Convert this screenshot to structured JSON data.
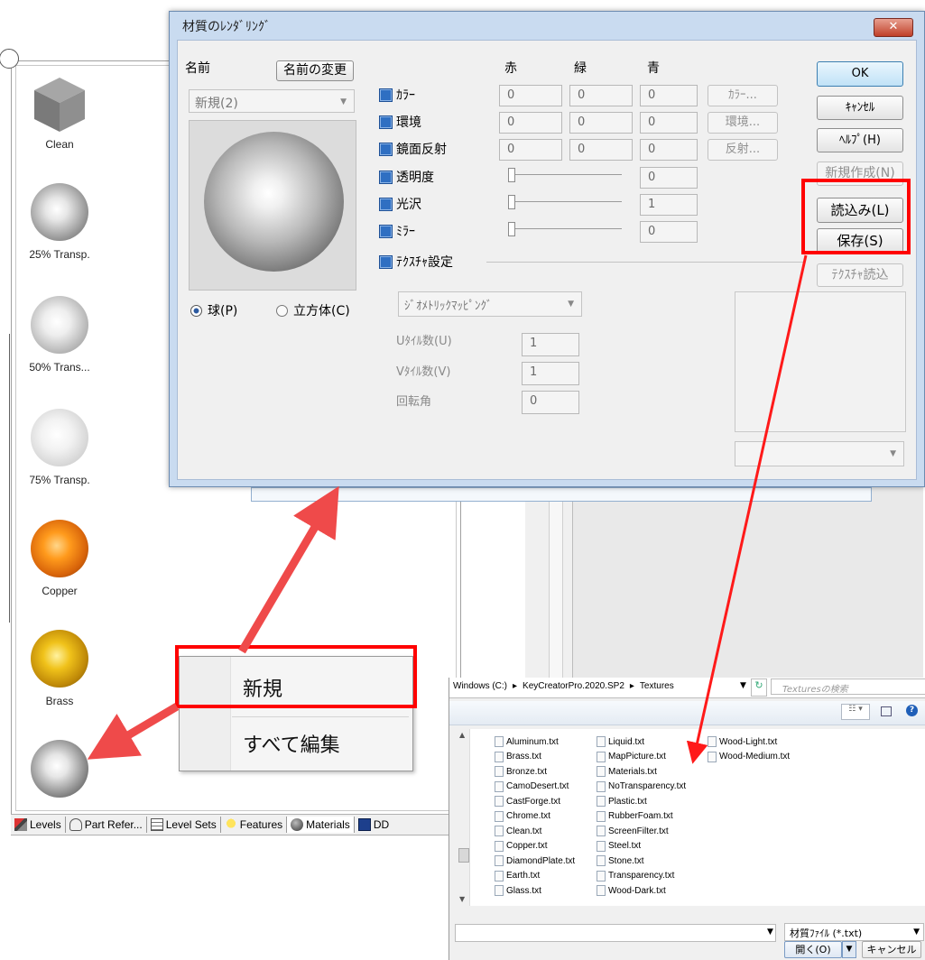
{
  "materials_panel": {
    "items": [
      {
        "label": "Clean"
      },
      {
        "label": "25% Transp."
      },
      {
        "label": "50% Trans..."
      },
      {
        "label": "75% Transp."
      },
      {
        "label": "Copper"
      },
      {
        "label": "Brass"
      }
    ],
    "tabs": [
      {
        "label": "Levels",
        "icon": "levels-icon"
      },
      {
        "label": "Part Refer...",
        "icon": "part-references-icon"
      },
      {
        "label": "Level Sets",
        "icon": "level-sets-icon"
      },
      {
        "label": "Features",
        "icon": "lightbulb-icon"
      },
      {
        "label": "Materials",
        "icon": "materials-globe-icon"
      },
      {
        "label": "DD",
        "icon": "dd-icon"
      }
    ]
  },
  "dialog": {
    "title": "材質のﾚﾝﾀﾞﾘﾝｸﾞ",
    "close_label": "✕",
    "name_label": "名前",
    "rename_button": "名前の変更",
    "name_value": "新規(2)",
    "preview_shape_sphere": "球(P)",
    "preview_shape_cube": "立方体(C)",
    "col_red": "赤",
    "col_green": "緑",
    "col_blue": "青",
    "rows": [
      {
        "label": "ｶﾗｰ",
        "r": "0",
        "g": "0",
        "b": "0",
        "button": "ｶﾗｰ..."
      },
      {
        "label": "環境",
        "r": "0",
        "g": "0",
        "b": "0",
        "button": "環境..."
      },
      {
        "label": "鏡面反射",
        "r": "0",
        "g": "0",
        "b": "0",
        "button": "反射..."
      }
    ],
    "sliders": [
      {
        "label": "透明度",
        "value": "0"
      },
      {
        "label": "光沢",
        "value": "1"
      },
      {
        "label": "ﾐﾗｰ",
        "value": "0"
      }
    ],
    "texture_section": "ﾃｸｽﾁｬ設定",
    "mapping_value": "ｼﾞｵﾒﾄﾘｯｸﾏｯﾋﾟﾝｸﾞ",
    "u_tiles_label": "Uﾀｲﾙ数(U)",
    "u_tiles_value": "1",
    "v_tiles_label": "Vﾀｲﾙ数(V)",
    "v_tiles_value": "1",
    "rotation_label": "回転角",
    "rotation_value": "0",
    "buttons": {
      "ok": "OK",
      "cancel": "ｷｬﾝｾﾙ",
      "help": "ﾍﾙﾌﾟ(H)",
      "new": "新規作成(N)",
      "load": "読込み(L)",
      "save": "保存(S)",
      "texture_load": "ﾃｸｽﾁｬ読込"
    }
  },
  "context_menu": {
    "items": [
      "新規",
      "すべて編集"
    ]
  },
  "file_dialog": {
    "breadcrumb": [
      "Windows (C:)",
      "KeyCreatorPro.2020.SP2",
      "Textures"
    ],
    "search_placeholder": "Texturesの検索",
    "files_col1": [
      "Aluminum.txt",
      "Brass.txt",
      "Bronze.txt",
      "CamoDesert.txt",
      "CastForge.txt",
      "Chrome.txt",
      "Clean.txt",
      "Copper.txt",
      "DiamondPlate.txt",
      "Earth.txt",
      "Glass.txt"
    ],
    "files_col2": [
      "Liquid.txt",
      "MapPicture.txt",
      "Materials.txt",
      "NoTransparency.txt",
      "Plastic.txt",
      "RubberFoam.txt",
      "ScreenFilter.txt",
      "Steel.txt",
      "Stone.txt",
      "Transparency.txt",
      "Wood-Dark.txt"
    ],
    "files_col3": [
      "Wood-Light.txt",
      "Wood-Medium.txt"
    ],
    "filename_value": "",
    "filter_value": "材質ﾌｧｲﾙ (*.txt)",
    "open_button": "開く(O)",
    "cancel_button": "キャンセル"
  },
  "colors": {
    "highlight": "#ff0000",
    "arrow": "#ef4a4a",
    "dialog_frame": "#c9dbf0"
  }
}
